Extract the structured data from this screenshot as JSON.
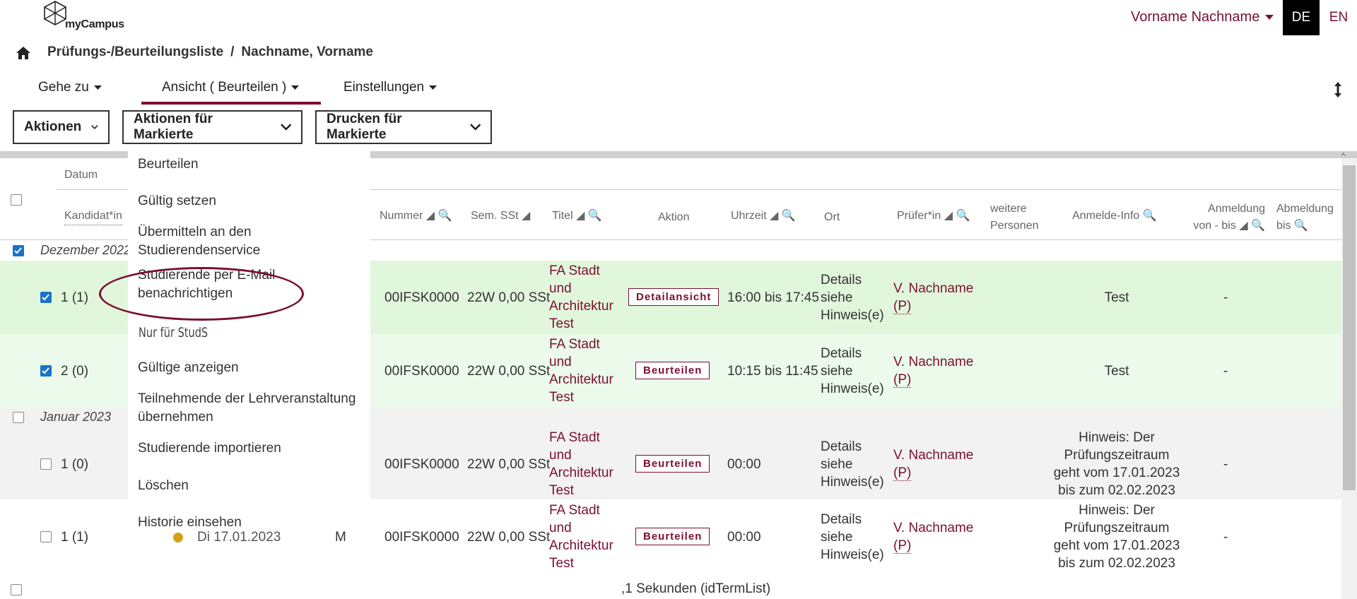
{
  "header": {
    "logo_text": "myCampus",
    "user_name": "Vorname Nachname",
    "lang_active": "DE",
    "lang_other": "EN"
  },
  "breadcrumb": {
    "page": "Prüfungs-/Beurteilungsliste",
    "separator": "/",
    "person": "Nachname, Vorname"
  },
  "nav": {
    "goto": "Gehe zu",
    "view": "Ansicht ( Beurteilen )",
    "settings": "Einstellungen"
  },
  "toolbar": {
    "actions": "Aktionen",
    "actions_marked": "Aktionen für Markierte",
    "print_marked": "Drucken für Markierte"
  },
  "dropdown": {
    "items": [
      "Beurteilen",
      "Gültig setzen",
      "Übermitteln an den Studierendenservice",
      "Studierende per E-Mail benachrichtigen",
      "Gültige anzeigen",
      "Teilnehmende der Lehrveranstaltung übernehmen",
      "Studierende importieren",
      "Löschen",
      "Historie einsehen"
    ],
    "section_label": "Nur für StudS"
  },
  "table": {
    "headers": {
      "date": "Datum",
      "candidate": "Kandidat*in",
      "number": "Nummer",
      "semester": "Sem. SSt",
      "title": "Titel",
      "action": "Aktion",
      "time": "Uhrzeit",
      "location": "Ort",
      "examiner": "Prüfer*in",
      "others": "weitere Personen",
      "reg_info": "Anmelde-Info",
      "registration": "Anmeldung von - bis",
      "deregistration": "Abmeldung bis"
    },
    "groups": [
      {
        "label": "Dezember 2022"
      },
      {
        "label": "Januar 2023"
      }
    ],
    "rows": [
      {
        "candidate": "1 (1)",
        "number": "00IFSK0000",
        "sem": "22W 0,00 SSt",
        "title": "FA Stadt und Architektur Test",
        "action": "Detailansicht",
        "time": "16:00 bis 17:45",
        "location": "Details siehe Hinweis(e)",
        "examiner": "V. Nachname",
        "examiner_role": "(P)",
        "info": "Test",
        "registration": "-"
      },
      {
        "candidate": "2 (0)",
        "number": "00IFSK0000",
        "sem": "22W 0,00 SSt",
        "title": "FA Stadt und Architektur Test",
        "action": "Beurteilen",
        "time": "10:15 bis 11:45",
        "location": "Details siehe Hinweis(e)",
        "examiner": "V. Nachname",
        "examiner_role": "(P)",
        "info": "Test",
        "registration": "-"
      },
      {
        "candidate": "1 (0)",
        "number": "00IFSK0000",
        "sem": "22W 0,00 SSt",
        "title": "FA Stadt und Architektur Test",
        "action": "Beurteilen",
        "time": "00:00",
        "location": "Details siehe Hinweis(e)",
        "examiner": "V. Nachname",
        "examiner_role": "(P)",
        "info": "Hinweis: Der Prüfungszeitraum geht vom 17.01.2023 bis zum 02.02.2023",
        "registration": "-"
      },
      {
        "candidate": "1 (1)",
        "date_partial": "Di 17.01.2023",
        "type_partial": "M",
        "number": "00IFSK0000",
        "sem": "22W 0,00 SSt",
        "title": "FA Stadt und Architektur Test",
        "action": "Beurteilen",
        "time": "00:00",
        "location": "Details siehe Hinweis(e)",
        "examiner": "V. Nachname",
        "examiner_role": "(P)",
        "info": "Hinweis: Der Prüfungszeitraum geht vom 17.01.2023 bis zum 02.02.2023",
        "registration": "-"
      }
    ]
  },
  "footer": {
    "text": ",1 Sekunden (idTermList)"
  },
  "colors": {
    "accent": "#7a1030",
    "row_green": "#e1f7dc",
    "row_green_light": "#ebfaea",
    "checkbox": "#1a73c8"
  }
}
